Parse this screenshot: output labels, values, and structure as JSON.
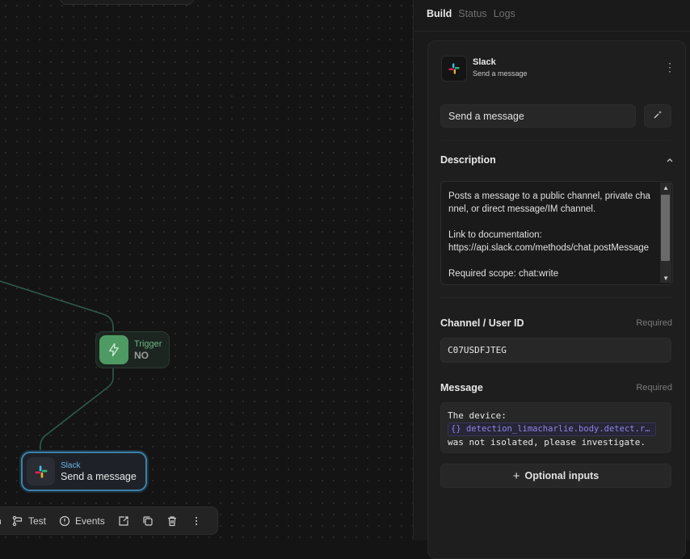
{
  "canvas": {
    "trigger_node": {
      "type_label": "Trigger",
      "value": "NO"
    },
    "slack_node": {
      "app_label": "Slack",
      "action_label": "Send a message"
    }
  },
  "toolbar": {
    "items": [
      {
        "label": "Test",
        "icon": "branch-icon"
      },
      {
        "label": "Events",
        "icon": "info-circle-icon"
      },
      {
        "label": "",
        "icon": "export-icon"
      },
      {
        "label": "",
        "icon": "copy-icon"
      },
      {
        "label": "",
        "icon": "trash-icon"
      },
      {
        "label": "",
        "icon": "more-vertical-icon"
      }
    ]
  },
  "panel": {
    "tabs": [
      {
        "label": "Build",
        "active": true
      },
      {
        "label": "Status",
        "active": false
      },
      {
        "label": "Logs",
        "active": false
      }
    ],
    "header": {
      "title": "Slack",
      "subtitle": "Send a message"
    },
    "name_value": "Send a message",
    "description": {
      "label": "Description",
      "text": "Posts a message to a public channel, private channel, or direct message/IM channel.\n\nLink to documentation:\nhttps://api.slack.com/methods/chat.postMessage\n\nRequired scope: chat:write"
    },
    "channel": {
      "label": "Channel / User ID",
      "required": "Required",
      "value": "C07USDFJTEG"
    },
    "message": {
      "label": "Message",
      "required": "Required",
      "line1": "The device:",
      "variable": "detection_limacharlie.body.detect.routing.hostname",
      "line3": "was not isolated, please investigate."
    },
    "optional_inputs": "Optional inputs"
  },
  "colors": {
    "accent_blue": "#3f7fa6",
    "trigger_green": "#4e9a63",
    "variable_purple": "#8f84e8"
  }
}
